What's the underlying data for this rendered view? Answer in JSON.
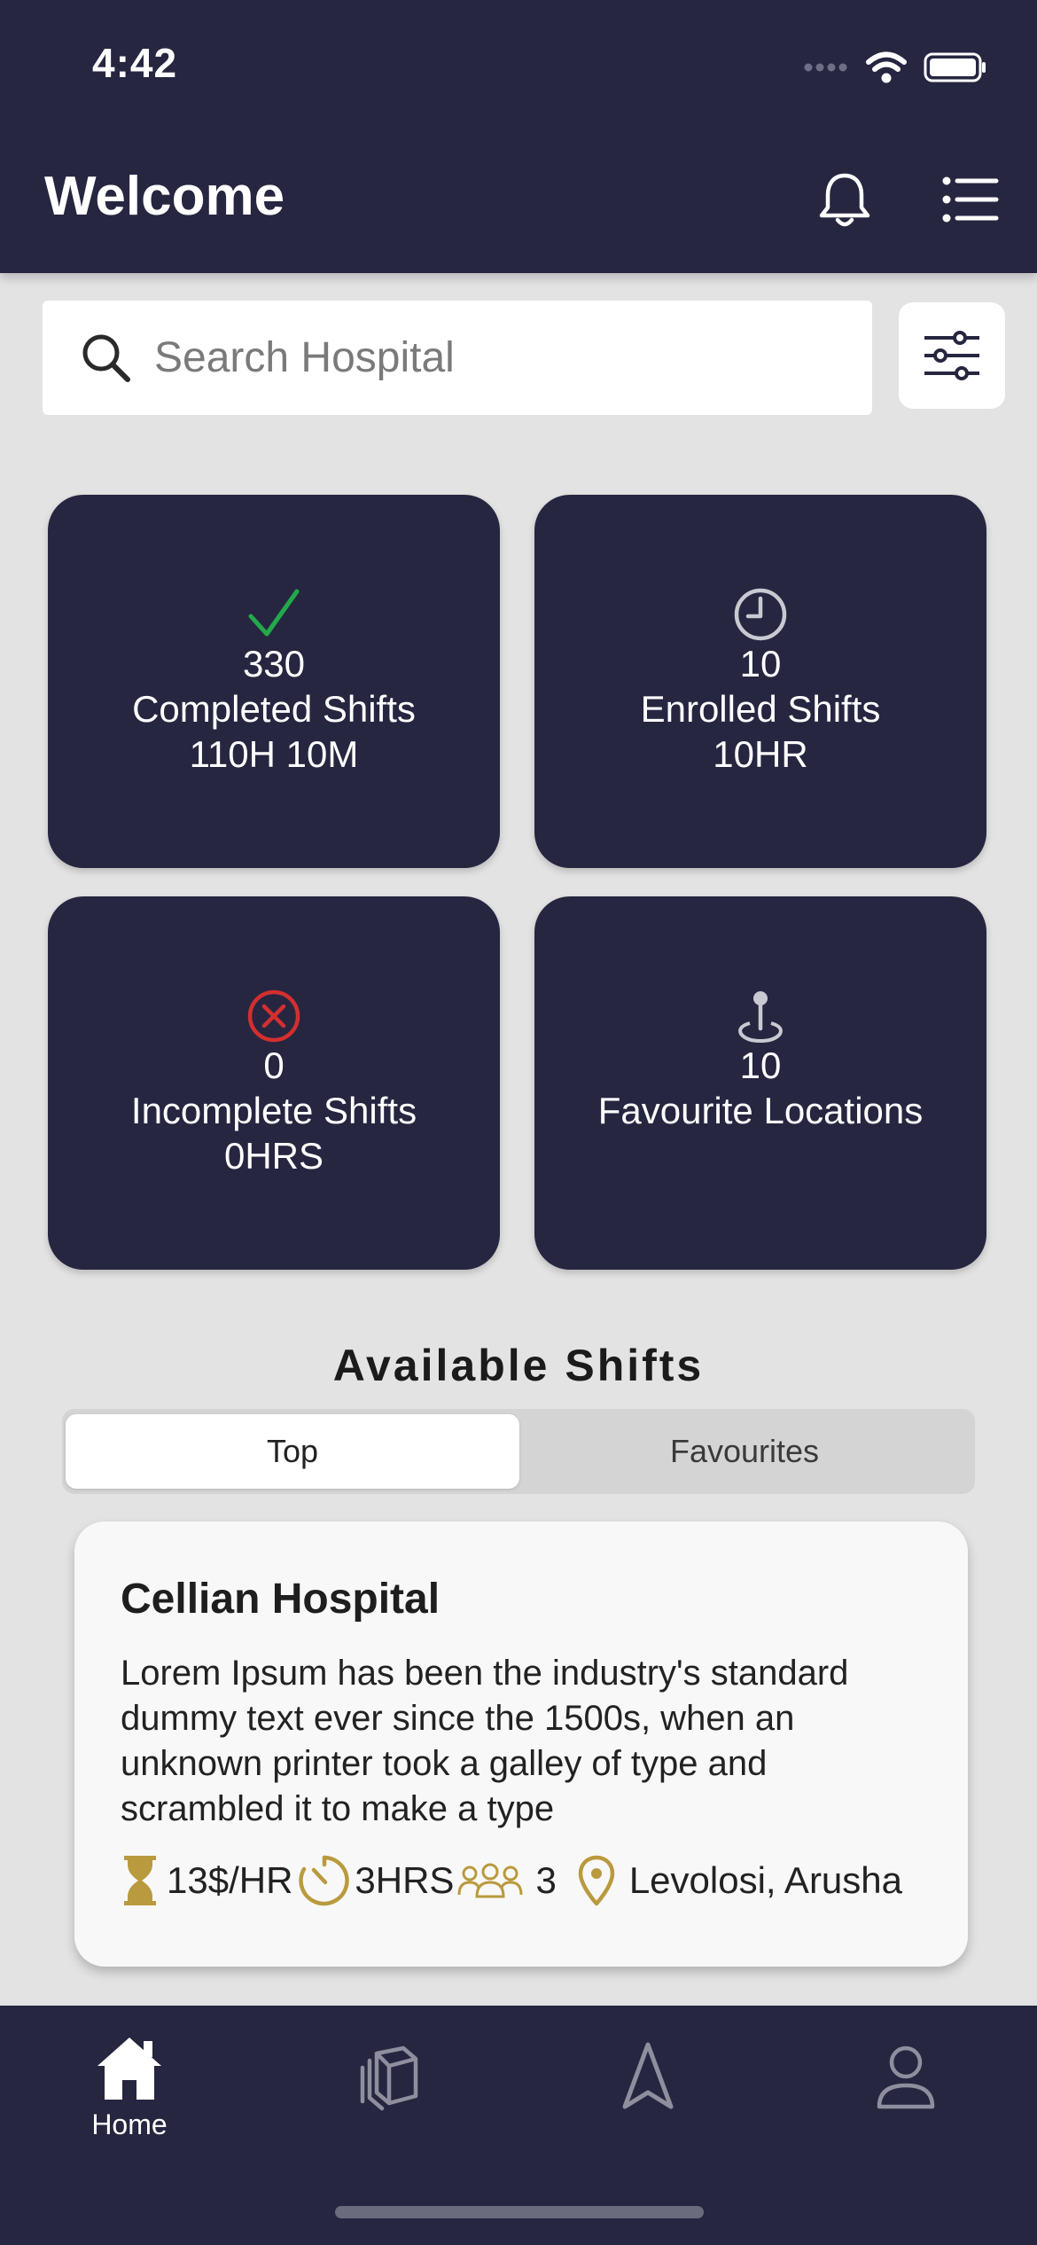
{
  "status_bar": {
    "time": "4:42"
  },
  "header": {
    "title": "Welcome",
    "icons": [
      "bell-icon",
      "menu-list-icon"
    ]
  },
  "search": {
    "placeholder": "Search Hospital",
    "value": "",
    "filter_icon": "sliders-icon"
  },
  "stats": [
    {
      "icon": "check-icon",
      "icon_color": "#22a94b",
      "count": "330",
      "label": "Completed Shifts",
      "sub": "110H 10M"
    },
    {
      "icon": "clock-icon",
      "icon_color": "#c9c9d2",
      "count": "10",
      "label": "Enrolled Shifts",
      "sub": "10HR"
    },
    {
      "icon": "x-circle-icon",
      "icon_color": "#d32f2f",
      "count": "0",
      "label": "Incomplete Shifts",
      "sub": "0HRS"
    },
    {
      "icon": "location-pin-icon",
      "icon_color": "#c9c9d2",
      "count": "10",
      "label": "Favourite Locations",
      "sub": ""
    }
  ],
  "available_shifts": {
    "title": "Available Shifts",
    "tabs": [
      {
        "label": "Top",
        "active": true
      },
      {
        "label": "Favourites",
        "active": false
      }
    ]
  },
  "shift_card": {
    "hospital": "Cellian Hospital",
    "description": "Lorem Ipsum has been the industry's standard dummy text ever since the 1500s, when an unknown printer took a galley of type and scrambled it to make a type",
    "rate": "13$/HR",
    "duration": "3HRS",
    "people": "3",
    "location": "Levolosi, Arusha",
    "accent_color": "#b99a3e"
  },
  "bottom_nav": {
    "items": [
      {
        "label": "Home",
        "icon": "home-icon",
        "active": true
      },
      {
        "label": "",
        "icon": "layers-icon",
        "active": false
      },
      {
        "label": "",
        "icon": "navigation-icon",
        "active": false
      },
      {
        "label": "",
        "icon": "user-icon",
        "active": false
      }
    ]
  },
  "colors": {
    "primary": "#262641",
    "background": "#e3e3e3"
  }
}
